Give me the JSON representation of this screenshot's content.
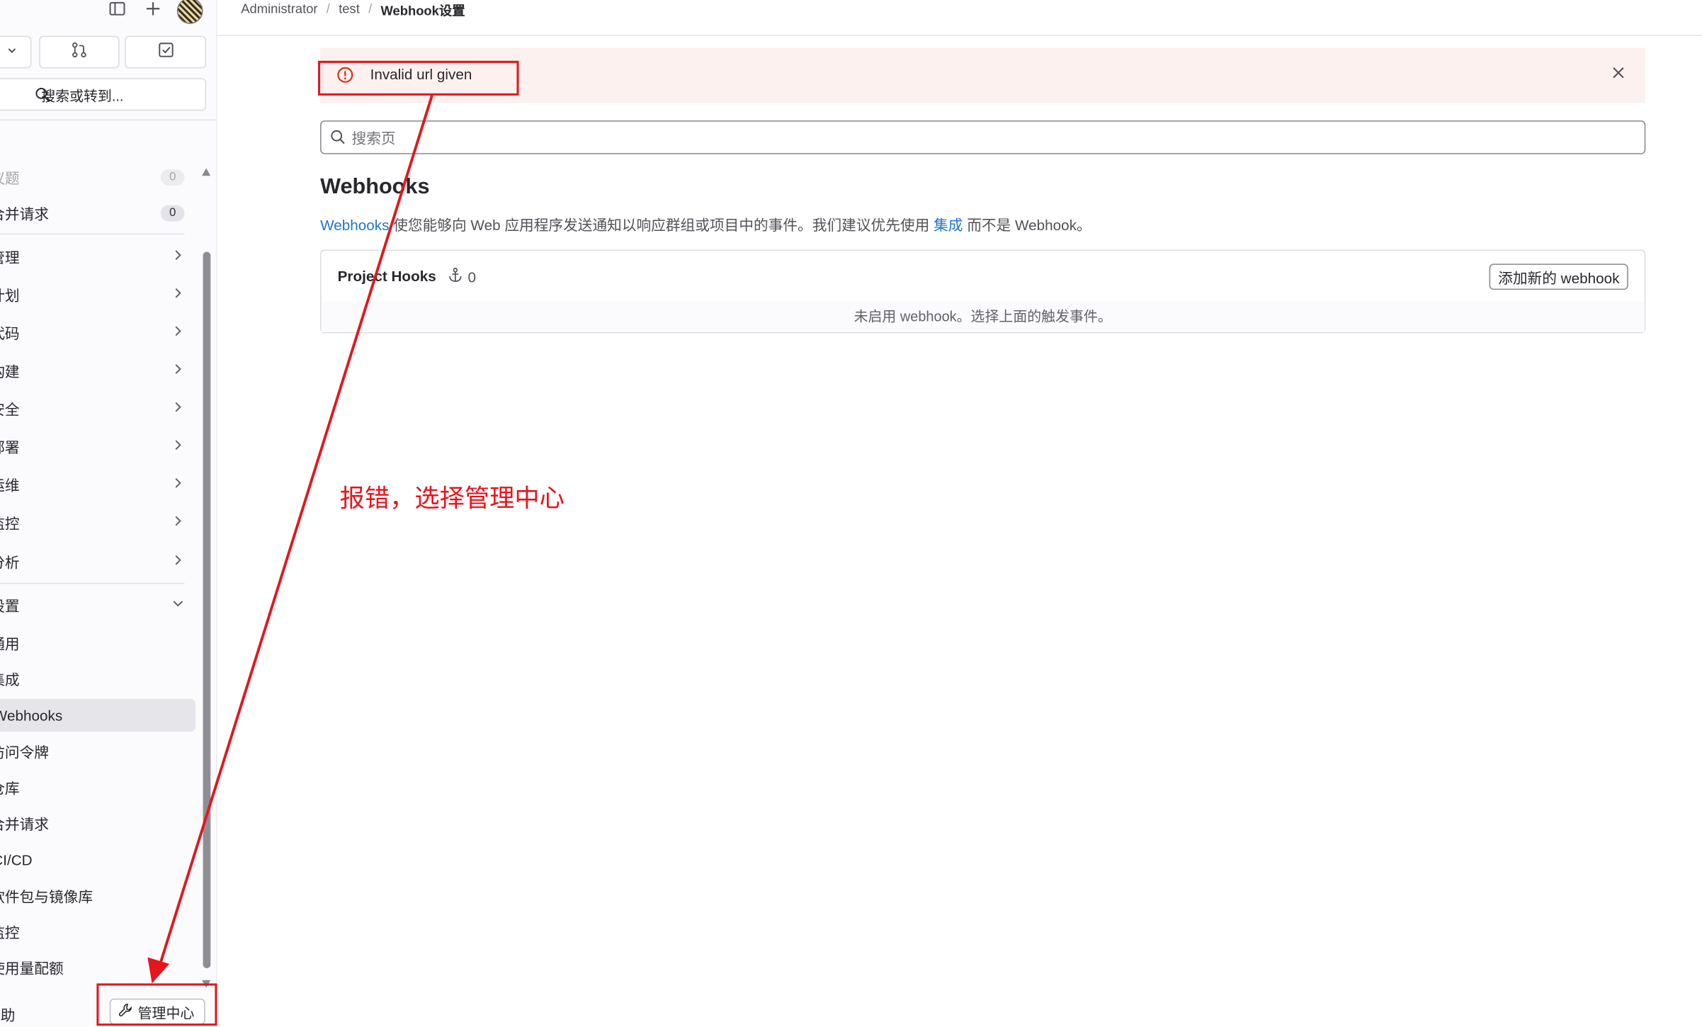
{
  "breadcrumb": {
    "items": [
      "Administrator",
      "test"
    ],
    "separator": "/",
    "current": "Webhook设置"
  },
  "sidebar": {
    "search_label": "搜索或转到...",
    "items": [
      {
        "label": "议题",
        "count": "0"
      },
      {
        "label": "合并请求",
        "count": "0"
      },
      {
        "label": "管理"
      },
      {
        "label": "计划"
      },
      {
        "label": "代码"
      },
      {
        "label": "构建"
      },
      {
        "label": "安全"
      },
      {
        "label": "部署"
      },
      {
        "label": "运维"
      },
      {
        "label": "监控"
      },
      {
        "label": "分析"
      },
      {
        "label": "设置"
      }
    ],
    "settings_subitems": [
      "通用",
      "集成",
      "Webhooks",
      "访问令牌",
      "仓库",
      "合并请求",
      "CI/CD",
      "软件包与镜像库",
      "监控",
      "使用量配额"
    ],
    "help_label": "帮助",
    "admin_button": "管理中心"
  },
  "alert": {
    "message": "Invalid url given"
  },
  "page_search": {
    "placeholder": "搜索页"
  },
  "page": {
    "title": "Webhooks",
    "desc_link": "Webhooks",
    "desc_mid": " 使您能够向 Web 应用程序发送通知以响应群组或项目中的事件。我们建议优先使用 ",
    "desc_link2": "集成",
    "desc_end": " 而不是 Webhook。"
  },
  "hooks_card": {
    "title": "Project Hooks",
    "count": "0",
    "add_button": "添加新的 webhook",
    "empty_text": "未启用 webhook。选择上面的触发事件。"
  },
  "annotation": {
    "text": "报错，选择管理中心",
    "color": "#e5151c"
  },
  "colors": {
    "link": "#1f75cb",
    "alert_bg": "#fdf1ef",
    "danger": "#dd2b0e"
  }
}
